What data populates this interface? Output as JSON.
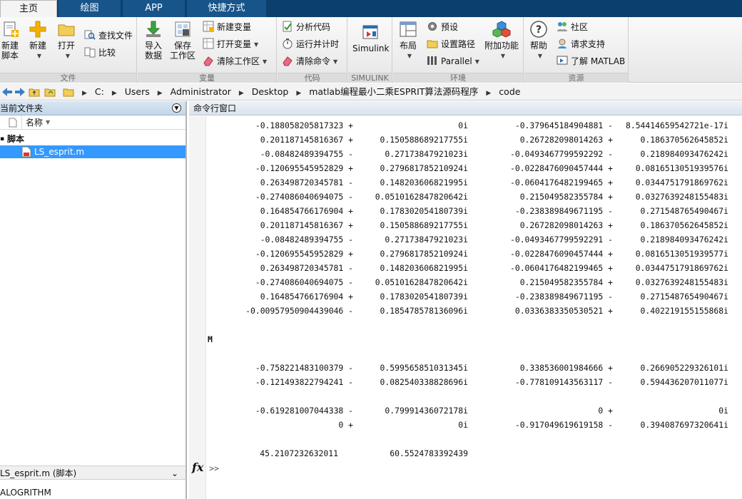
{
  "tabs": [
    "主页",
    "绘图",
    "APP",
    "快捷方式"
  ],
  "ribbon": {
    "groups": {
      "file": "文件",
      "variable": "变量",
      "code": "代码",
      "simulink": "SIMULINK",
      "environment": "环境",
      "resources": "资源"
    },
    "new_script_line1": "新建",
    "new_script_line2": "脚本",
    "new": "新建",
    "open": "打开",
    "find_files": "查找文件",
    "compare": "比较",
    "import_line1": "导入",
    "import_line2": "数据",
    "save_line1": "保存",
    "save_line2": "工作区",
    "new_variable": "新建变量",
    "open_variable": "打开变量",
    "clear_workspace": "清除工作区",
    "analyze_code": "分析代码",
    "run_and_time": "运行并计时",
    "clear_commands": "清除命令",
    "simulink": "Simulink",
    "layout": "布局",
    "preferences": "预设",
    "set_path": "设置路径",
    "parallel": "Parallel",
    "addons": "附加功能",
    "help": "帮助",
    "community": "社区",
    "request_support": "请求支持",
    "learn_matlab": "了解 MATLAB"
  },
  "address": {
    "segments": [
      "C:",
      "Users",
      "Administrator",
      "Desktop",
      "matlab编程最小二乘ESPRIT算法源码程序",
      "code"
    ]
  },
  "file_browser": {
    "title": "当前文件夹",
    "column_name": "名称",
    "group_label": "脚本",
    "selected_file": "LS_esprit.m",
    "details_title": "LS_esprit.m (脚本)",
    "details_text": "ALOGRITHM"
  },
  "command_window": {
    "title": "命令行窗口",
    "matrix_rows": [
      [
        "-0.188058205817323 +",
        "0i",
        "-0.379645184904881 -",
        "8.54414659542721e-17i"
      ],
      [
        "0.201187145816367 +",
        "0.150588689217755i",
        "0.267282098014263 +",
        "0.186370562645852i"
      ],
      [
        "-0.08482489394755 -",
        "0.27173847921023i",
        "-0.0493467799592292 -",
        "0.218984093476242i"
      ],
      [
        "-0.120695545952829 +",
        "0.279681785210924i",
        "-0.0228476090457444 +",
        "0.0816513051939576i"
      ],
      [
        "0.263498720345781 -",
        "0.148203606821995i",
        "-0.0604176482199465 +",
        "0.0344751791869762i"
      ],
      [
        "-0.274086040694075 -",
        "0.0510162847820642i",
        "0.215049582355784 +",
        "0.0327639248155483i"
      ],
      [
        "0.164854766176904 +",
        "0.178302054180739i",
        "-0.238389849671195 -",
        "0.271548765490467i"
      ],
      [
        "0.201187145816367 +",
        "0.150588689217755i",
        "0.267282098014263 +",
        "0.186370562645852i"
      ],
      [
        "-0.08482489394755 -",
        "0.27173847921023i",
        "-0.0493467799592291 -",
        "0.218984093476242i"
      ],
      [
        "-0.120695545952829 +",
        "0.279681785210924i",
        "-0.0228476090457444 +",
        "0.0816513051939577i"
      ],
      [
        "0.263498720345781 -",
        "0.148203606821995i",
        "-0.0604176482199465 +",
        "0.0344751791869762i"
      ],
      [
        "-0.274086040694075 -",
        "0.0510162847820642i",
        "0.215049582355784 +",
        "0.0327639248155483i"
      ],
      [
        "0.164854766176904 +",
        "0.178302054180739i",
        "-0.238389849671195 -",
        "0.271548765490467i"
      ],
      [
        "-0.00957950904439046 -",
        "0.185478578136096i",
        "0.0336383350530521 +",
        "0.402219155155868i"
      ]
    ],
    "var_label": "M",
    "m_rows": [
      [
        "-0.758221483100379 -",
        "0.599565851031345i",
        "0.338536001984666 +",
        "0.266905229326101i"
      ],
      [
        "-0.121493822794241 -",
        "0.082540338828696i",
        "-0.778109143563117 -",
        "0.594436207011077i"
      ]
    ],
    "d_rows": [
      [
        "-0.619281007044338 -",
        "0.79991436072178i",
        "0 +",
        "0i"
      ],
      [
        "0 +",
        "0i",
        "-0.917049619619158 -",
        "0.394087697320641i"
      ]
    ],
    "result_values": [
      "45.2107232632011",
      "60.5524783392439"
    ],
    "fx_label": "fx",
    "prompt": ">>"
  },
  "colors": {
    "tabbar": "#0b3f6e",
    "tab": "#17548a",
    "selection": "#3399ff"
  }
}
